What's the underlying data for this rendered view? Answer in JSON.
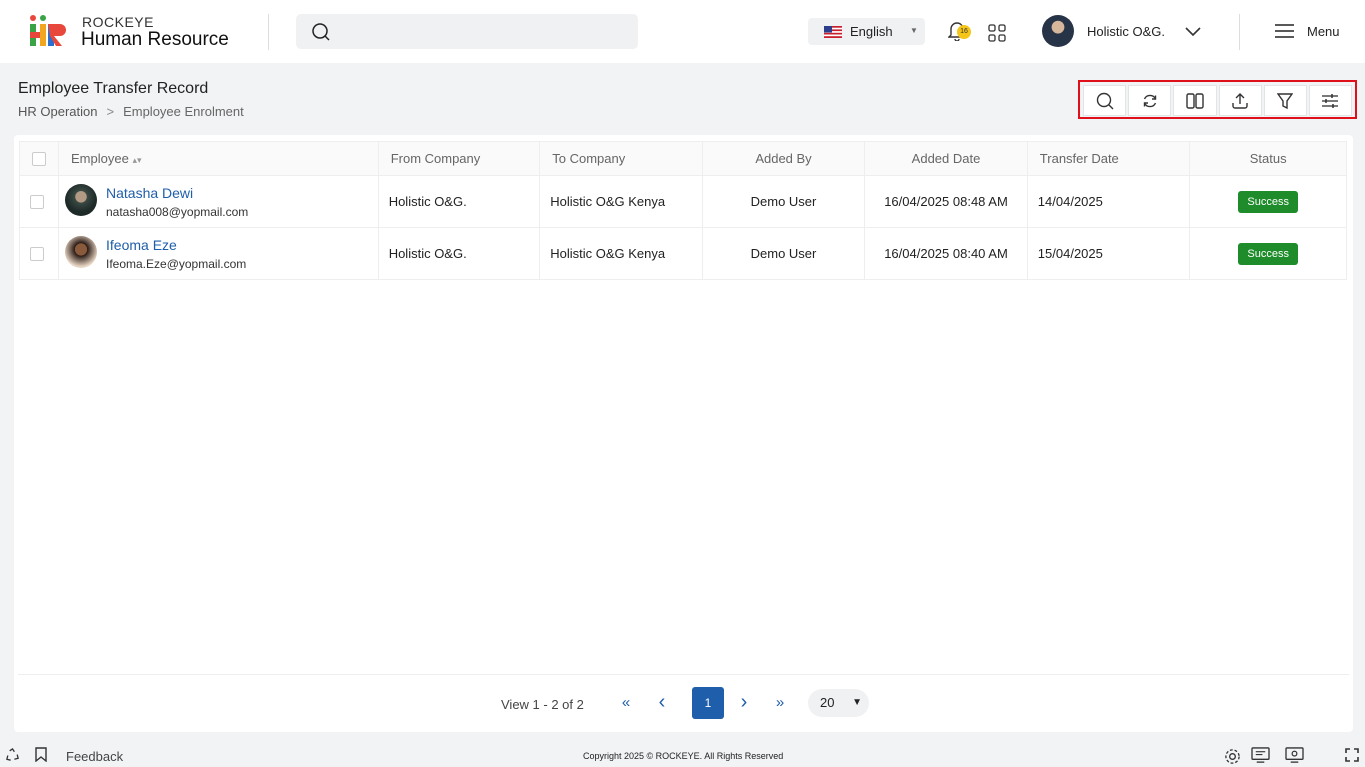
{
  "header": {
    "brand_top": "ROCKEYE",
    "brand_main": "Human Resource",
    "search_placeholder": "",
    "language": "English",
    "notification_count": "16",
    "user_name": "Holistic O&G.",
    "menu_label": "Menu"
  },
  "page": {
    "title": "Employee Transfer Record",
    "breadcrumb": [
      "HR Operation",
      "Employee Enrolment"
    ]
  },
  "toolbar": [
    "search-icon",
    "refresh-icon",
    "columns-icon",
    "export-icon",
    "filter-icon",
    "settings-sliders-icon"
  ],
  "table": {
    "headers": [
      "Employee",
      "From Company",
      "To Company",
      "Added By",
      "Added Date",
      "Transfer Date",
      "Status"
    ],
    "rows": [
      {
        "name": "Natasha Dewi",
        "email": "natasha008@yopmail.com",
        "from": "Holistic O&G.",
        "to": "Holistic O&G Kenya",
        "added_by": "Demo User",
        "added_date": "16/04/2025 08:48 AM",
        "transfer_date": "14/04/2025",
        "status": "Success"
      },
      {
        "name": "Ifeoma Eze",
        "email": "Ifeoma.Eze@yopmail.com",
        "from": "Holistic O&G.",
        "to": "Holistic O&G Kenya",
        "added_by": "Demo User",
        "added_date": "16/04/2025 08:40 AM",
        "transfer_date": "15/04/2025",
        "status": "Success"
      }
    ]
  },
  "pagination": {
    "info": "View 1 - 2 of 2",
    "first": "«",
    "prev": "‹",
    "current": "1",
    "next": "›",
    "last": "»",
    "page_size": "20"
  },
  "footer": {
    "feedback": "Feedback",
    "copyright": "Copyright 2025 © ROCKEYE. All Rights Reserved"
  },
  "colors": {
    "accent": "#1f5eaa",
    "success": "#1e8c2a",
    "highlight": "#e0101a"
  }
}
